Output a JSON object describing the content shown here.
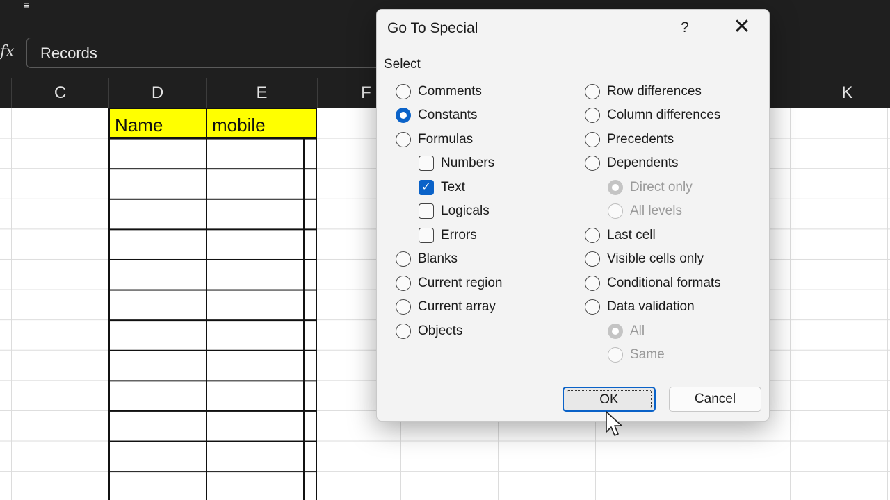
{
  "formula_bar": {
    "fx_label": "fx",
    "value": "Records"
  },
  "columns": [
    "C",
    "D",
    "E",
    "F",
    "K"
  ],
  "cells": {
    "d_header": "Name",
    "e_header": "mobile"
  },
  "dialog": {
    "title": "Go To Special",
    "help_label": "?",
    "close_label": "✕",
    "group_label": "Select",
    "left_options": [
      {
        "label": "Comments"
      },
      {
        "label": "Constants"
      },
      {
        "label": "Formulas"
      },
      {
        "label": "Numbers"
      },
      {
        "label": "Text"
      },
      {
        "label": "Logicals"
      },
      {
        "label": "Errors"
      },
      {
        "label": "Blanks"
      },
      {
        "label": "Current region"
      },
      {
        "label": "Current array"
      },
      {
        "label": "Objects"
      }
    ],
    "right_options": [
      {
        "label": "Row differences"
      },
      {
        "label": "Column differences"
      },
      {
        "label": "Precedents"
      },
      {
        "label": "Dependents"
      },
      {
        "label": "Direct only"
      },
      {
        "label": "All levels"
      },
      {
        "label": "Last cell"
      },
      {
        "label": "Visible cells only"
      },
      {
        "label": "Conditional formats"
      },
      {
        "label": "Data validation"
      },
      {
        "label": "All"
      },
      {
        "label": "Same"
      }
    ],
    "ok_label": "OK",
    "cancel_label": "Cancel"
  },
  "colors": {
    "accent": "#0a62c8",
    "header_fill": "#ffff00",
    "dark_chrome": "#1f1f1f"
  }
}
